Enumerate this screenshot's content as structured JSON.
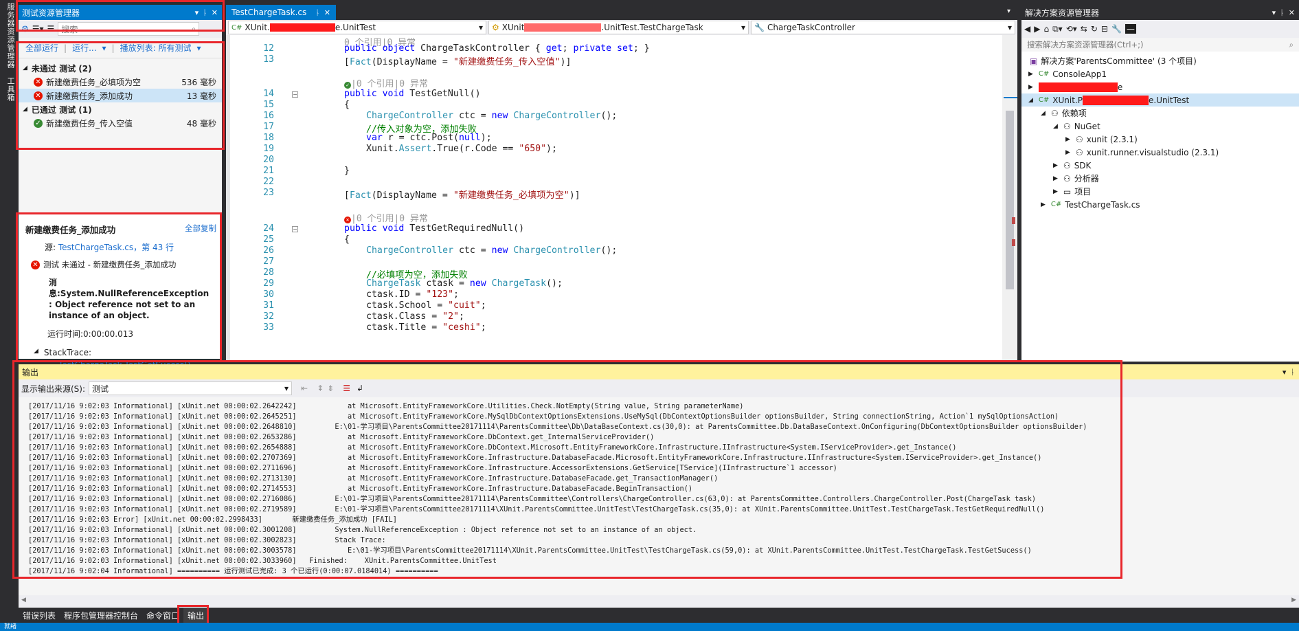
{
  "left_vertical_tabs": [
    "服务器资源管理器",
    "工具箱"
  ],
  "test_explorer": {
    "title": "测试资源管理器",
    "search_placeholder": "搜索",
    "run_all": "全部运行",
    "run": "运行...",
    "playlist": "播放列表: 所有测试",
    "failed_group": "未通过 测试 (2)",
    "passed_group": "已通过 测试 (1)",
    "failed_tests": [
      {
        "name": "新建缴费任务_必填项为空",
        "time": "536 毫秒"
      },
      {
        "name": "新建缴费任务_添加成功",
        "time": "13 毫秒"
      }
    ],
    "passed_tests": [
      {
        "name": "新建缴费任务_传入空值",
        "time": "48 毫秒"
      }
    ]
  },
  "test_detail": {
    "title": "新建缴费任务_添加成功",
    "copy_all": "全部复制",
    "source_label": "源:",
    "source_link": "TestChargeTask.cs，第 43 行",
    "result": "测试 未通过 - 新建缴费任务_添加成功",
    "message": "消息:System.NullReferenceException : Object reference not set to an instance of an object.",
    "elapsed": "运行时间:0:00:00.013",
    "stacktrace_label": "StackTrace:",
    "stacktrace_link": "TestChargeTask.TestGetSucess()"
  },
  "editor": {
    "tab_name": "TestChargeTask.cs",
    "combo1": "XUnit.",
    "combo1_suffix": "e.UnitTest",
    "combo2": "XUnit",
    "combo2_suffix": ".UnitTest.TestChargeTask",
    "combo3": "ChargeTaskController",
    "codelens_top": "0 个引用|0 异常",
    "lines": [
      {
        "n": "12",
        "html": "public object ChargeTaskController { get; private set; }"
      },
      {
        "n": "13",
        "html": "[Fact(DisplayName = \"新建缴费任务_传入空值\")]"
      },
      {
        "n": "14",
        "html": "public void TestGetNull()"
      },
      {
        "n": "15",
        "html": "{"
      },
      {
        "n": "16",
        "html": "ChargeController ctc = new ChargeController();"
      },
      {
        "n": "17",
        "html": "//传入对象为空，添加失败"
      },
      {
        "n": "18",
        "html": "var r = ctc.Post(null);"
      },
      {
        "n": "19",
        "html": "Xunit.Assert.True(r.Code == \"650\");"
      },
      {
        "n": "20",
        "html": ""
      },
      {
        "n": "21",
        "html": "}"
      },
      {
        "n": "22",
        "html": ""
      },
      {
        "n": "23",
        "html": "[Fact(DisplayName = \"新建缴费任务_必填项为空\")]"
      },
      {
        "n": "24",
        "html": "public void TestGetRequiredNull()"
      },
      {
        "n": "25",
        "html": "{"
      },
      {
        "n": "26",
        "html": "ChargeController ctc = new ChargeController();"
      },
      {
        "n": "27",
        "html": ""
      },
      {
        "n": "28",
        "html": "//必填项为空，添加失败"
      },
      {
        "n": "29",
        "html": "ChargeTask ctask = new ChargeTask();"
      },
      {
        "n": "30",
        "html": "ctask.ID = \"123\";"
      },
      {
        "n": "31",
        "html": "ctask.School = \"cuit\";"
      },
      {
        "n": "32",
        "html": "ctask.Class = \"2\";"
      },
      {
        "n": "33",
        "html": "ctask.Title = \"ceshi\";"
      }
    ],
    "codelens_mid": "|0 个引用|0 异常"
  },
  "solution_explorer": {
    "title": "解决方案资源管理器",
    "search_placeholder": "搜索解决方案资源管理器(Ctrl+;)",
    "solution": "解决方案'ParentsCommittee' (3 个项目)",
    "items": [
      {
        "label": "ConsoleApp1"
      },
      {
        "label": "e"
      },
      {
        "label": "XUnit.P",
        "suffix": "e.UnitTest"
      },
      {
        "label": "依赖项"
      },
      {
        "label": "NuGet"
      },
      {
        "label": "xunit (2.3.1)"
      },
      {
        "label": "xunit.runner.visualstudio (2.3.1)"
      },
      {
        "label": "SDK"
      },
      {
        "label": "分析器"
      },
      {
        "label": "项目"
      },
      {
        "label": "TestChargeTask.cs"
      }
    ]
  },
  "output": {
    "title": "输出",
    "source_label": "显示输出来源(S):",
    "source_value": "测试",
    "lines": [
      "[2017/11/16 9:02:03 Informational] [xUnit.net 00:00:02.2642242]            at Microsoft.EntityFrameworkCore.Utilities.Check.NotEmpty(String value, String parameterName)",
      "[2017/11/16 9:02:03 Informational] [xUnit.net 00:00:02.2645251]            at Microsoft.EntityFrameworkCore.MySqlDbContextOptionsExtensions.UseMySql(DbContextOptionsBuilder optionsBuilder, String connectionString, Action`1 mySqlOptionsAction)",
      "[2017/11/16 9:02:03 Informational] [xUnit.net 00:00:02.2648810]         E:\\01-学习项目\\ParentsCommittee20171114\\ParentsCommittee\\Db\\DataBaseContext.cs(30,0): at ParentsCommittee.Db.DataBaseContext.OnConfiguring(DbContextOptionsBuilder optionsBuilder)",
      "[2017/11/16 9:02:03 Informational] [xUnit.net 00:00:02.2653286]            at Microsoft.EntityFrameworkCore.DbContext.get_InternalServiceProvider()",
      "[2017/11/16 9:02:03 Informational] [xUnit.net 00:00:02.2654888]            at Microsoft.EntityFrameworkCore.DbContext.Microsoft.EntityFrameworkCore.Infrastructure.IInfrastructure<System.IServiceProvider>.get_Instance()",
      "[2017/11/16 9:02:03 Informational] [xUnit.net 00:00:02.2707369]            at Microsoft.EntityFrameworkCore.Infrastructure.DatabaseFacade.Microsoft.EntityFrameworkCore.Infrastructure.IInfrastructure<System.IServiceProvider>.get_Instance()",
      "[2017/11/16 9:02:03 Informational] [xUnit.net 00:00:02.2711696]            at Microsoft.EntityFrameworkCore.Infrastructure.AccessorExtensions.GetService[TService](IInfrastructure`1 accessor)",
      "[2017/11/16 9:02:03 Informational] [xUnit.net 00:00:02.2713130]            at Microsoft.EntityFrameworkCore.Infrastructure.DatabaseFacade.get_TransactionManager()",
      "[2017/11/16 9:02:03 Informational] [xUnit.net 00:00:02.2714553]            at Microsoft.EntityFrameworkCore.Infrastructure.DatabaseFacade.BeginTransaction()",
      "[2017/11/16 9:02:03 Informational] [xUnit.net 00:00:02.2716086]         E:\\01-学习项目\\ParentsCommittee20171114\\ParentsCommittee\\Controllers\\ChargeController.cs(63,0): at ParentsCommittee.Controllers.ChargeController.Post(ChargeTask task)",
      "[2017/11/16 9:02:03 Informational] [xUnit.net 00:00:02.2719589]         E:\\01-学习项目\\ParentsCommittee20171114\\XUnit.ParentsCommittee.UnitTest\\TestChargeTask.cs(35,0): at XUnit.ParentsCommittee.UnitTest.TestChargeTask.TestGetRequiredNull()",
      "[2017/11/16 9:02:03 Error] [xUnit.net 00:00:02.2998433]       新建缴费任务_添加成功 [FAIL]",
      "[2017/11/16 9:02:03 Informational] [xUnit.net 00:00:02.3001208]         System.NullReferenceException : Object reference not set to an instance of an object.",
      "[2017/11/16 9:02:03 Informational] [xUnit.net 00:00:02.3002823]         Stack Trace:",
      "[2017/11/16 9:02:03 Informational] [xUnit.net 00:00:02.3003578]            E:\\01-学习项目\\ParentsCommittee20171114\\XUnit.ParentsCommittee.UnitTest\\TestChargeTask.cs(59,0): at XUnit.ParentsCommittee.UnitTest.TestChargeTask.TestGetSucess()",
      "[2017/11/16 9:02:03 Informational] [xUnit.net 00:00:02.3033960]   Finished:    XUnit.ParentsCommittee.UnitTest",
      "[2017/11/16 9:02:04 Informational] ========== 运行测试已完成: 3 个已运行(0:00:07.0184014) =========="
    ]
  },
  "bottom_tabs": [
    "错误列表",
    "程序包管理器控制台",
    "命令窗口",
    "输出"
  ],
  "status_bar": "就绪"
}
